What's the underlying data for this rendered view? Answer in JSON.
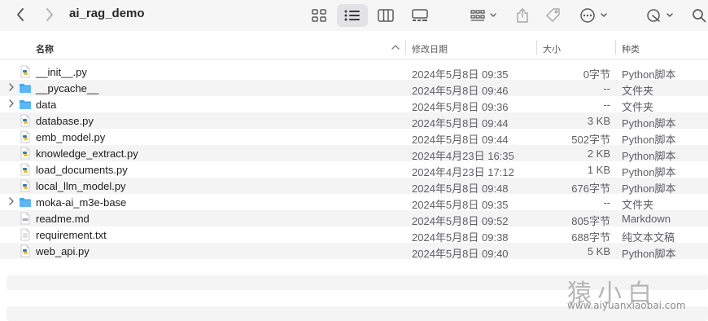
{
  "window": {
    "title": "ai_rag_demo"
  },
  "toolbar": {
    "icons": [
      "back-icon",
      "forward-icon",
      "icon-view-icon",
      "list-view-icon",
      "column-view-icon",
      "gallery-view-icon",
      "group-icon",
      "share-icon",
      "tag-icon",
      "more-icon",
      "markup-icon",
      "search-icon"
    ]
  },
  "columns": {
    "name": "名称",
    "date": "修改日期",
    "size": "大小",
    "kind": "种类"
  },
  "files": [
    {
      "name": "__init__.py",
      "date": "2024年5月8日 09:35",
      "size": "0字节",
      "kind": "Python脚本",
      "type": "py",
      "folder": false
    },
    {
      "name": "__pycache__",
      "date": "2024年5月8日 09:46",
      "size": "--",
      "kind": "文件夹",
      "type": "folder",
      "folder": true
    },
    {
      "name": "data",
      "date": "2024年5月8日 09:36",
      "size": "--",
      "kind": "文件夹",
      "type": "folder",
      "folder": true
    },
    {
      "name": "database.py",
      "date": "2024年5月8日 09:44",
      "size": "3 KB",
      "kind": "Python脚本",
      "type": "py",
      "folder": false
    },
    {
      "name": "emb_model.py",
      "date": "2024年5月8日 09:44",
      "size": "502字节",
      "kind": "Python脚本",
      "type": "py",
      "folder": false
    },
    {
      "name": "knowledge_extract.py",
      "date": "2024年4月23日 16:35",
      "size": "2 KB",
      "kind": "Python脚本",
      "type": "py",
      "folder": false
    },
    {
      "name": "load_documents.py",
      "date": "2024年4月23日 17:12",
      "size": "1 KB",
      "kind": "Python脚本",
      "type": "py",
      "folder": false
    },
    {
      "name": "local_llm_model.py",
      "date": "2024年5月8日 09:48",
      "size": "676字节",
      "kind": "Python脚本",
      "type": "py",
      "folder": false
    },
    {
      "name": "moka-ai_m3e-base",
      "date": "2024年5月8日 09:35",
      "size": "--",
      "kind": "文件夹",
      "type": "folder",
      "folder": true
    },
    {
      "name": "readme.md",
      "date": "2024年5月8日 09:52",
      "size": "805字节",
      "kind": "Markdown",
      "type": "md",
      "folder": false
    },
    {
      "name": "requirement.txt",
      "date": "2024年5月8日 09:38",
      "size": "688字节",
      "kind": "纯文本文稿",
      "type": "txt",
      "folder": false
    },
    {
      "name": "web_api.py",
      "date": "2024年5月8日 09:40",
      "size": "5 KB",
      "kind": "Python脚本",
      "type": "py",
      "folder": false
    }
  ],
  "watermark": {
    "text": "猿小白",
    "url": "www.aiyuanxiaobai.com"
  },
  "colors": {
    "folder": "#3ea6f2",
    "py_blue": "#3b78b3",
    "py_yellow": "#f2c230"
  }
}
